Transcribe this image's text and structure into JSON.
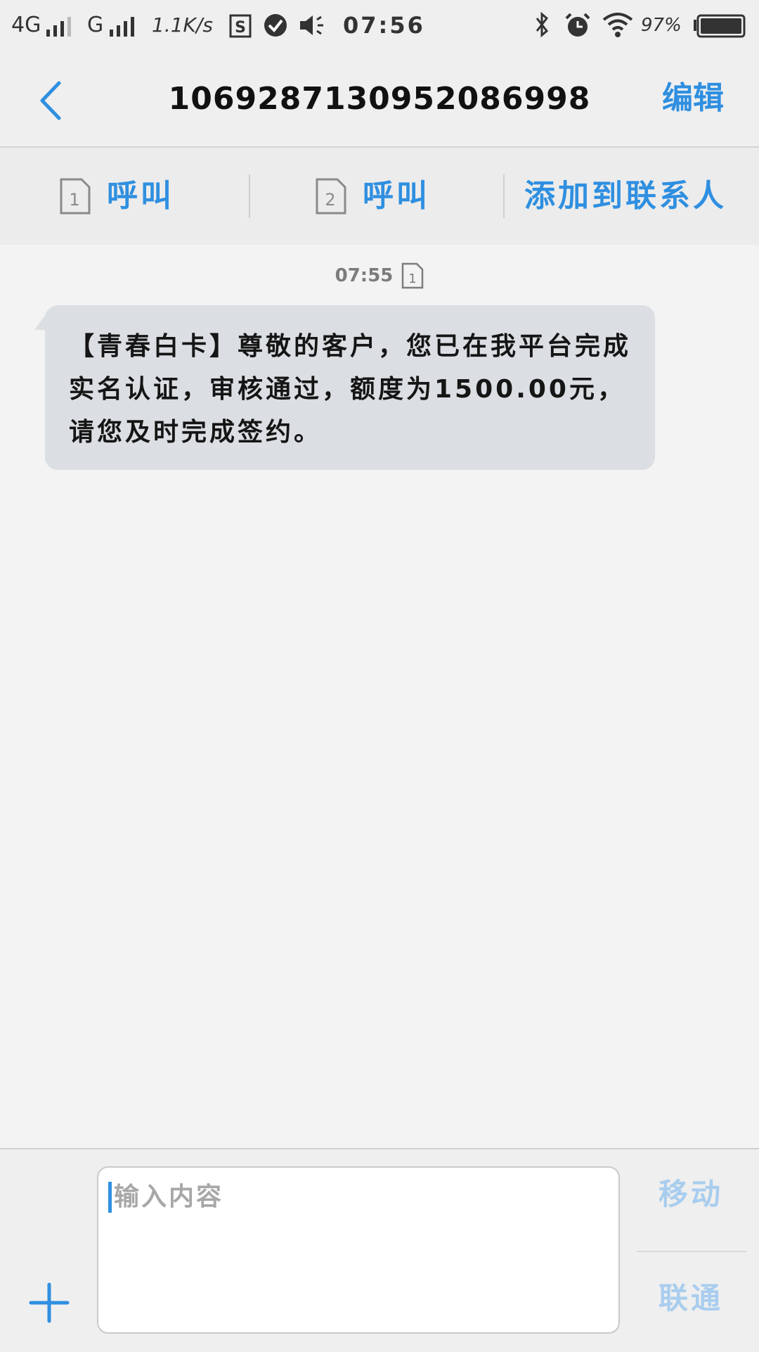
{
  "status_bar": {
    "network_1": "4G",
    "network_2": "G",
    "speed": "1.1K/s",
    "time": "07:56",
    "battery": "97%"
  },
  "header": {
    "title": "1069287130952086998",
    "edit_label": "编辑"
  },
  "actions": {
    "call_sim1": {
      "label": "呼叫",
      "sim": "1"
    },
    "call_sim2": {
      "label": "呼叫",
      "sim": "2"
    },
    "add_contact": "添加到联系人"
  },
  "conversation": {
    "timestamp": "07:55",
    "sim": "1",
    "messages": [
      {
        "text": "【青春白卡】尊敬的客户，您已在我平台完成实名认证，审核通过，额度为1500.00元，请您及时完成签约。"
      }
    ]
  },
  "composer": {
    "placeholder": "输入内容",
    "carrier_1": "移动",
    "carrier_2": "联通"
  },
  "colors": {
    "accent": "#2f8fe0",
    "bubble": "#dbdfe3",
    "disabled_accent": "#a9cdee"
  }
}
